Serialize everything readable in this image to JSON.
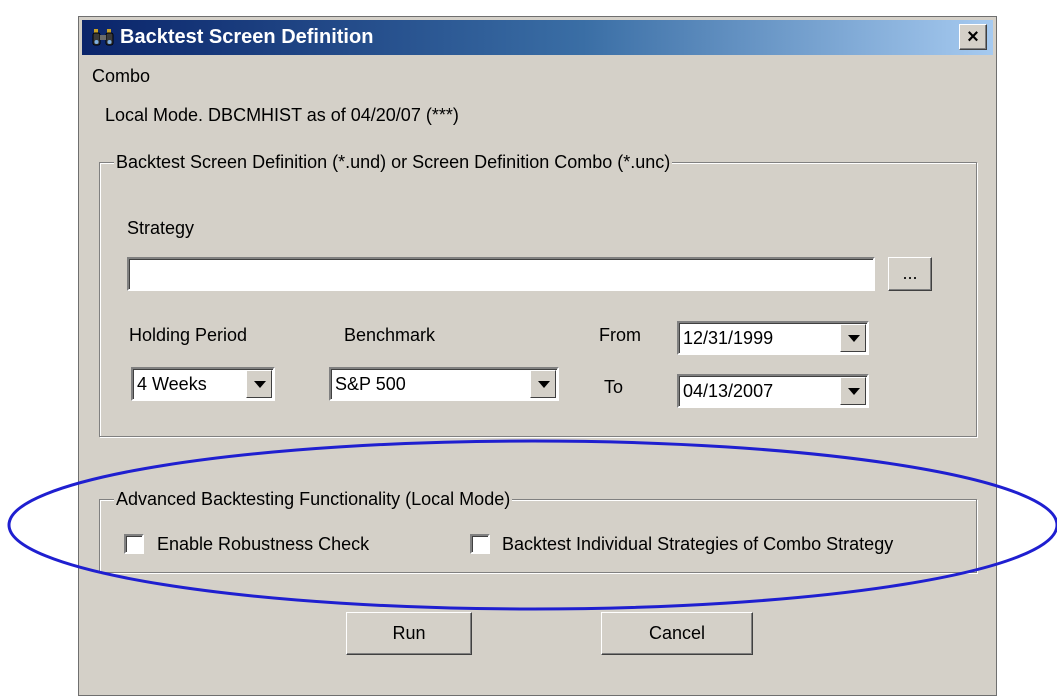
{
  "window": {
    "title": "Backtest Screen Definition",
    "icon": "binoculars-icon",
    "close_glyph": "×"
  },
  "menu": {
    "combo": "Combo"
  },
  "status_text": "Local Mode. DBCMHIST as of 04/20/07 (***)",
  "definition_group": {
    "legend": "Backtest Screen Definition (*.und) or Screen Definition Combo (*.unc)",
    "strategy_label": "Strategy",
    "strategy_value": "",
    "browse_label": "...",
    "holding_period_label": "Holding Period",
    "holding_period_value": "4 Weeks",
    "benchmark_label": "Benchmark",
    "benchmark_value": "S&P 500",
    "from_label": "From",
    "from_value": "12/31/1999",
    "to_label": "To",
    "to_value": "04/13/2007"
  },
  "advanced_group": {
    "legend": "Advanced Backtesting Functionality (Local Mode)",
    "robustness_label": "Enable Robustness Check",
    "robustness_checked": false,
    "individual_label": "Backtest Individual Strategies of Combo Strategy",
    "individual_checked": false
  },
  "buttons": {
    "run": "Run",
    "cancel": "Cancel"
  },
  "colors": {
    "dialog_bg": "#d4d0c8",
    "titlebar_start": "#0a246a",
    "titlebar_end": "#a6caf0",
    "annotation_ellipse": "#1f1fd0"
  }
}
